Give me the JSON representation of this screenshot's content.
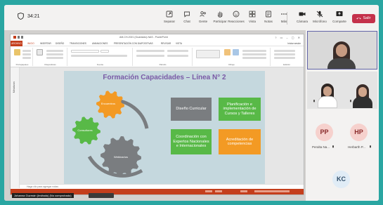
{
  "meeting": {
    "elapsed": "34:21"
  },
  "toolbar": {
    "items": [
      {
        "label": "Separar",
        "icon": "separate-icon"
      },
      {
        "label": "Chat",
        "icon": "chat-icon"
      },
      {
        "label": "Gente",
        "icon": "people-icon"
      },
      {
        "label": "Participar",
        "icon": "raise-hand-icon"
      },
      {
        "label": "Reacciones",
        "icon": "reactions-icon"
      },
      {
        "label": "Vista",
        "icon": "view-icon"
      },
      {
        "label": "Notas",
        "icon": "notes-icon"
      },
      {
        "label": "Más",
        "icon": "more-icon"
      }
    ],
    "camera_label": "Cámara",
    "mic_label": "Micrófono",
    "share_label": "Comparte",
    "leave_label": "Salir",
    "colors": {
      "leave": "#c4314b",
      "background": "#2aa6a2"
    }
  },
  "powerpoint": {
    "window_title": "AM-CH-2021 (Guardado)-NAS - PowerPoint",
    "file_tab": "ARCHIVO",
    "tabs": [
      "INICIO",
      "INSERTAR",
      "DISEÑO",
      "TRANSICIONES",
      "ANIMACIONES",
      "PRESENTACIÓN CON DIAPOSITIVAS",
      "REVISAR",
      "VISTA"
    ],
    "user": "Iniciar sesión",
    "ribbon_groups": [
      "Portapapeles",
      "Diapositivas",
      "Fuente",
      "Párrafo",
      "Dibujo",
      "Edición"
    ],
    "thumbnails_label": "Miniaturas",
    "notes_placeholder": "Haga clic para agregar notas",
    "accent": "#c43e1c"
  },
  "slide": {
    "title": "Formación Capacidades – Línea N° 2",
    "gears": [
      {
        "label": "Encuentros",
        "color": "#f39a24"
      },
      {
        "label": "Consultores",
        "color": "#58b947"
      },
      {
        "label": "Webinarios",
        "color": "#7a7d80"
      }
    ],
    "boxes": [
      {
        "text": "Diseño Curricular",
        "color": "#7a7d80"
      },
      {
        "text": "Planificación e implementación de Cursos y Talleres",
        "color": "#58b947"
      },
      {
        "text": "Coordinación con Expertos Nacionales e Internacionales",
        "color": "#58b947"
      },
      {
        "text": "Acreditación de competencias",
        "color": "#f39a24"
      }
    ]
  },
  "presenter_label": "Johanna Guzmán (Invitado) (No comprobado)",
  "participants": [
    {
      "initials": "PP",
      "name": "Peralta Na...",
      "color": "#f6d1cd",
      "text_color": "#8a2b2b"
    },
    {
      "initials": "HP",
      "name": "Herbarth P...",
      "color": "#f6d1cd",
      "text_color": "#8a2b2b"
    },
    {
      "initials": "KC",
      "name": "",
      "color": "#e0ecf6",
      "text_color": "#33506b"
    }
  ]
}
